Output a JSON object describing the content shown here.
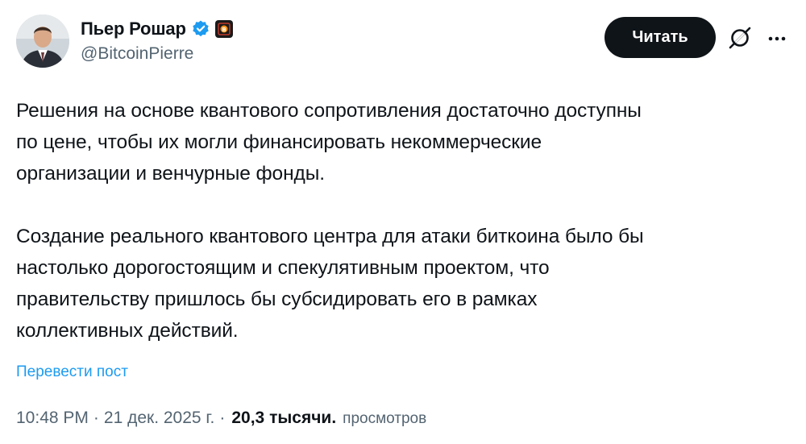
{
  "author": {
    "display_name": "Пьер Рошар",
    "handle": "@BitcoinPierre",
    "avatar_icon": "profile-photo",
    "verified_icon": "verified-badge-icon",
    "org_badge_icon": "bitcoin-org-badge-icon"
  },
  "actions": {
    "follow_label": "Читать",
    "grok_icon": "grok-icon",
    "more_icon": "more-options-icon"
  },
  "tweet": {
    "paragraphs": [
      "Решения на основе квантового сопротивления достаточно доступны\nпо цене, чтобы их могли финансировать некоммерческие\nорганизации и венчурные фонды.",
      "Создание реального квантового центра для атаки биткоина было бы\nнастолько дорогостоящим и спекулятивным проектом, что\nправительству пришлось бы субсидировать его в рамках\nколлективных действий."
    ],
    "translate_label": "Перевести пост"
  },
  "meta": {
    "time": "10:48 PM",
    "date": "21 дек. 2025 г.",
    "separator": "·",
    "views_count": "20,3 тысячи.",
    "views_label": "просмотров"
  },
  "colors": {
    "text": "#0f1419",
    "secondary": "#536471",
    "link": "#1d9bf0",
    "button_bg": "#0f1419"
  }
}
